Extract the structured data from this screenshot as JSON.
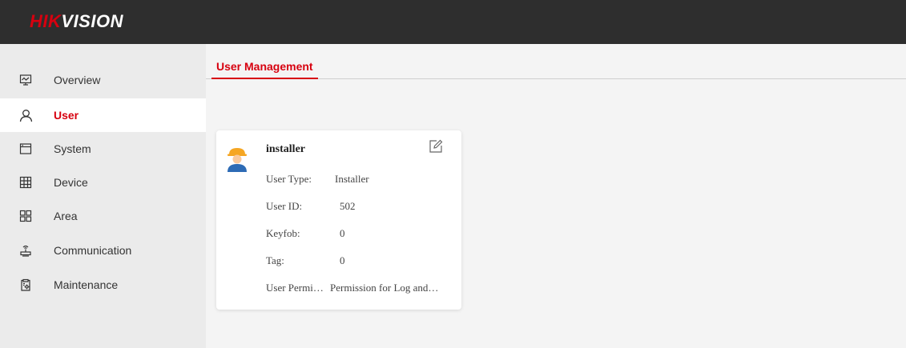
{
  "brand": {
    "part1": "HIK",
    "part2": "VISION"
  },
  "sidebar": {
    "items": [
      {
        "label": "Overview",
        "icon": "monitor-icon"
      },
      {
        "label": "User",
        "icon": "user-icon"
      },
      {
        "label": "System",
        "icon": "window-icon"
      },
      {
        "label": "Device",
        "icon": "grid-device-icon"
      },
      {
        "label": "Area",
        "icon": "area-squares-icon"
      },
      {
        "label": "Communication",
        "icon": "router-icon"
      },
      {
        "label": "Maintenance",
        "icon": "clipboard-gear-icon"
      }
    ],
    "active": "User"
  },
  "main": {
    "tab": "User Management",
    "card": {
      "name": "installer",
      "fields": [
        {
          "key": "User Type:",
          "value": "Installer"
        },
        {
          "key": "User ID:",
          "value": "502"
        },
        {
          "key": "Keyfob:",
          "value": "0"
        },
        {
          "key": "Tag:",
          "value": "0"
        },
        {
          "key": "User Permi…",
          "value": "Permission for Log and…"
        }
      ]
    }
  },
  "colors": {
    "accent": "#d7000f",
    "topbar": "#2e2e2e",
    "sidebar": "#ebebeb",
    "avatar_helmet": "#f5a623",
    "avatar_body": "#2d6bb5"
  }
}
